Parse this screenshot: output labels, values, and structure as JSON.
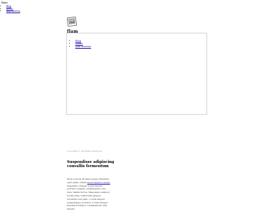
{
  "header": {
    "title": "flam",
    "nav": [
      {
        "label": "Blog"
      },
      {
        "label": "About"
      },
      {
        "label": "Ask Theresa"
      }
    ]
  },
  "brand": {
    "name": "flam",
    "logo_icon": "picture-frame-icon"
  },
  "panel": {
    "nav": [
      {
        "label": "Blog"
      },
      {
        "label": "About"
      },
      {
        "label": "Ask Theresa"
      }
    ]
  },
  "footer": {
    "copyright": "Copyright © All Rights Reserved"
  },
  "article": {
    "title": "Suspendisse adipiscing convallis fermentum",
    "body_before_link": "Proin a lacus sit amet augue interdum eget quam ornare ",
    "link_text": "lacus sapien a augue",
    "body_after_link": " imperdiet. Integer lorem mauris porttitor, magna condimentum odio nunc mattis luctus. Maecenas euismod mollis nulla sollicitudin aliquet. Curabitur sed justo. Lorem aliquet pellentesque porttitor. Lorem integer hendrerit tempor condimentum cras mauris."
  },
  "colors": {
    "link": "#1a0dab",
    "border": "#d3d3d3",
    "muted": "#999999"
  }
}
